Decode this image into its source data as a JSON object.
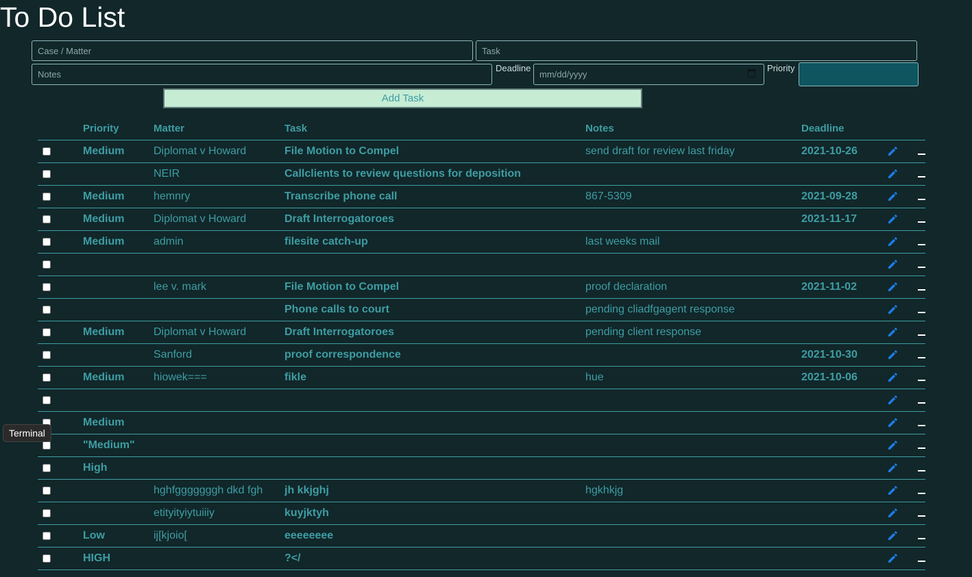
{
  "page": {
    "title": "To Do List"
  },
  "form": {
    "case_placeholder": "Case / Matter",
    "task_placeholder": "Task",
    "notes_placeholder": "Notes",
    "deadline_label": "Deadline",
    "deadline_placeholder": "mm/dd/yyyy",
    "priority_label": "Priority",
    "add_button": "Add Task"
  },
  "table": {
    "headers": {
      "priority": "Priority",
      "matter": "Matter",
      "task": "Task",
      "notes": "Notes",
      "deadline": "Deadline"
    },
    "rows": [
      {
        "priority": "Medium",
        "matter": "Diplomat v Howard",
        "task": "File Motion to Compel",
        "notes": "send draft for review last friday",
        "deadline": "2021-10-26"
      },
      {
        "priority": "",
        "matter": "NEIR",
        "task": "Callclients to review questions for deposition",
        "notes": "",
        "deadline": ""
      },
      {
        "priority": "Medium",
        "matter": "hemnry",
        "task": "Transcribe phone call",
        "notes": "867-5309",
        "deadline": "2021-09-28"
      },
      {
        "priority": "Medium",
        "matter": "Diplomat v Howard",
        "task": "Draft Interrogatoroes",
        "notes": "",
        "deadline": "2021-11-17"
      },
      {
        "priority": "Medium",
        "matter": "admin",
        "task": "filesite catch-up",
        "notes": "last weeks mail",
        "deadline": ""
      },
      {
        "priority": "",
        "matter": "",
        "task": "",
        "notes": "",
        "deadline": ""
      },
      {
        "priority": "",
        "matter": "lee v. mark",
        "task": "File Motion to Compel",
        "notes": "proof declaration",
        "deadline": "2021-11-02"
      },
      {
        "priority": "",
        "matter": "",
        "task": "Phone calls to court",
        "notes": "pending cliadfgagent response",
        "deadline": ""
      },
      {
        "priority": "Medium",
        "matter": "Diplomat v Howard",
        "task": "Draft Interrogatoroes",
        "notes": "pending client response",
        "deadline": ""
      },
      {
        "priority": "",
        "matter": "Sanford",
        "task": "proof correspondence",
        "notes": "",
        "deadline": "2021-10-30"
      },
      {
        "priority": "Medium",
        "matter": "hiowek===",
        "task": "fikle",
        "notes": "hue",
        "deadline": "2021-10-06"
      },
      {
        "priority": "",
        "matter": "",
        "task": "",
        "notes": "",
        "deadline": ""
      },
      {
        "priority": "Medium",
        "matter": "",
        "task": "",
        "notes": "",
        "deadline": ""
      },
      {
        "priority": "\"Medium\"",
        "matter": "",
        "task": "",
        "notes": "",
        "deadline": ""
      },
      {
        "priority": "High",
        "matter": "",
        "task": "",
        "notes": "",
        "deadline": ""
      },
      {
        "priority": "",
        "matter": "hghfgggggggh dkd fgh",
        "task": "jh kkjghj",
        "notes": "hgkhkjg",
        "deadline": ""
      },
      {
        "priority": "",
        "matter": "etityityiytuiiiy",
        "task": "kuyjktyh",
        "notes": "",
        "deadline": ""
      },
      {
        "priority": "Low",
        "matter": "ij[kjoio[",
        "task": "eeeeeeee",
        "notes": "",
        "deadline": ""
      },
      {
        "priority": "HIGH",
        "matter": "",
        "task": "?</",
        "notes": "",
        "deadline": ""
      }
    ]
  },
  "tooltip": {
    "text": "Terminal"
  },
  "icons": {
    "edit": "pencil-icon",
    "delete": "minus-icon",
    "calendar": "calendar-icon"
  },
  "colors": {
    "background": "#11272a",
    "accent": "#3e9da3",
    "button": "#c6ecd4",
    "priority_select": "#0e5560",
    "edit_icon": "#1e7be6"
  }
}
